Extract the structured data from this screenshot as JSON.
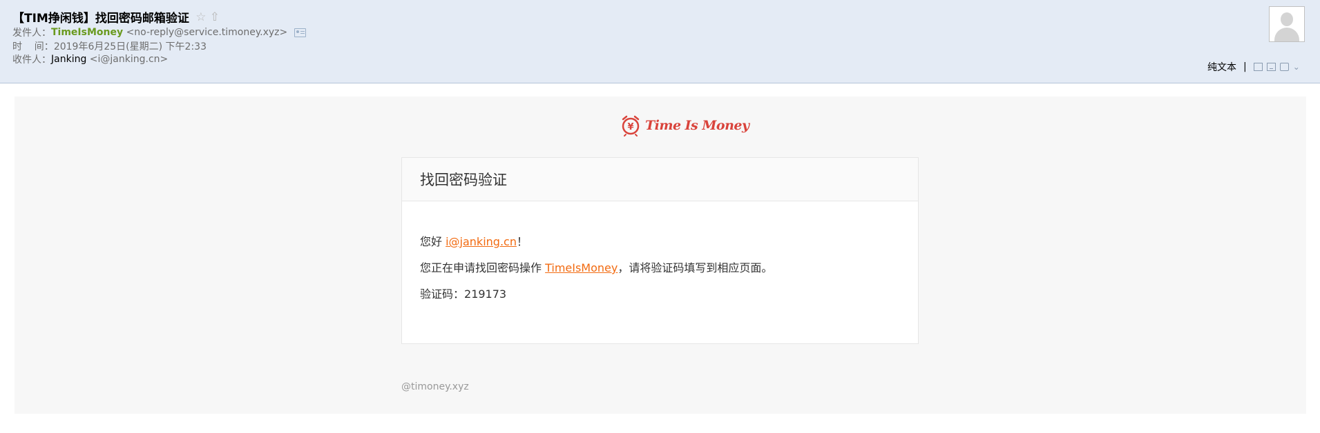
{
  "header": {
    "subject": "【TIM挣闲钱】找回密码邮箱验证",
    "from_label": "发件人：",
    "from_name": "TimeIsMoney",
    "from_email": "<no-reply@service.timoney.xyz>",
    "time_label": "时    间：",
    "time_value": "2019年6月25日(星期二) 下午2:33",
    "to_label": "收件人：",
    "to_name": "Janking",
    "to_email": "<i@janking.cn>",
    "plain_text": "纯文本",
    "separator": "|",
    "icons": [
      "star-icon",
      "flag-icon",
      "contact-card-icon",
      "window-icon",
      "download-icon",
      "print-icon",
      "chevron-down-icon"
    ]
  },
  "body": {
    "brand": "Time Is Money",
    "card_title": "找回密码验证",
    "greeting_prefix": "您好 ",
    "greeting_link": "i@janking.cn",
    "greeting_suffix": "！",
    "line2_prefix": "您正在申请找回密码操作 ",
    "line2_link": "TimeIsMoney",
    "line2_suffix": "，请将验证码填写到相应页面。",
    "code_label": "验证码：",
    "code_value": "219173",
    "footer": "@timoney.xyz"
  },
  "colors": {
    "link": "#f26a10",
    "brand": "#d9433b",
    "sender": "#6a9a1f",
    "header_bg": "#e4ebf5"
  }
}
